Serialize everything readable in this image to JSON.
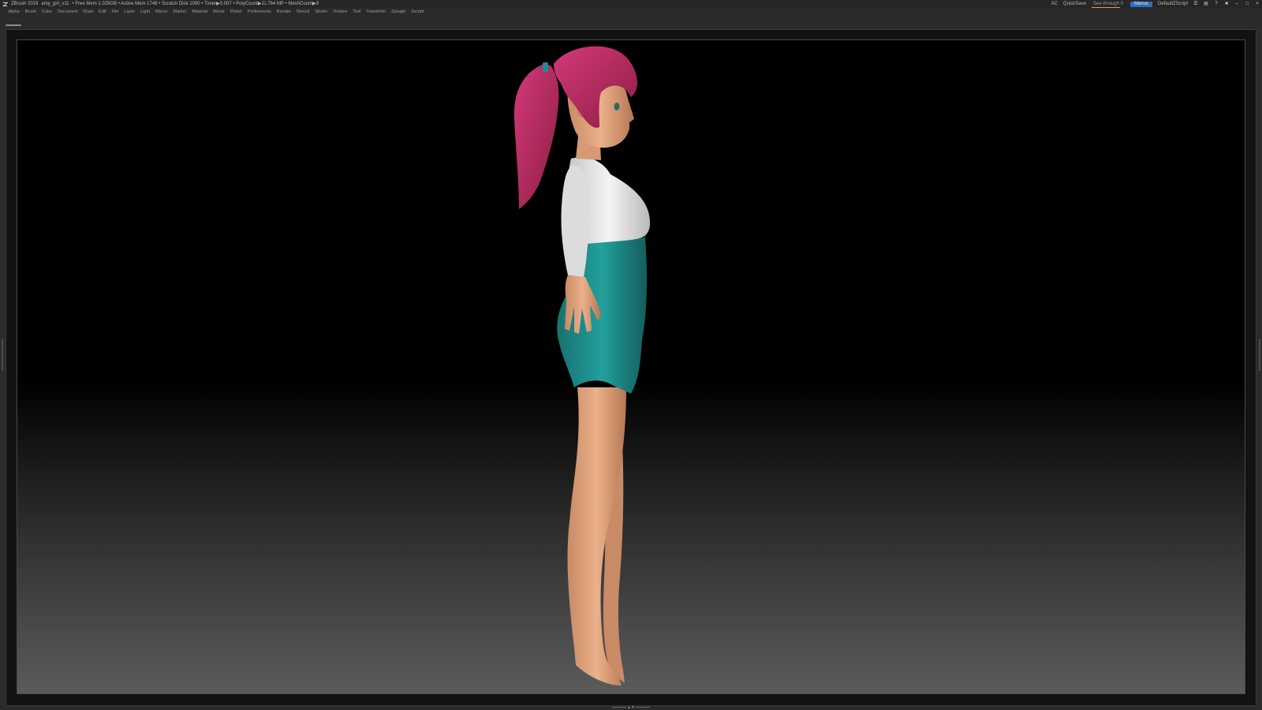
{
  "titlebar": {
    "app": "ZBrush 2019",
    "document": "amy_girl_v11",
    "stats": "• Free Mem 1.029GB • Active Mem 1748 • Scratch Disk 1090 • Timer▶0.007 • PolyCount▶11.764 MP • MeshCount▶9",
    "ac": "AC",
    "quicksave": "QuickSave",
    "see_through": "See-through  0",
    "menus_btn": "Menus",
    "script": "DefaultZScript"
  },
  "menubar": {
    "items": [
      "Alpha",
      "Brush",
      "Color",
      "Document",
      "Draw",
      "Edit",
      "File",
      "Layer",
      "Light",
      "Macro",
      "Marker",
      "Material",
      "Movie",
      "Picker",
      "Preferences",
      "Render",
      "Stencil",
      "Stroke",
      "Texture",
      "Tool",
      "Transform",
      "Zplugin",
      "Zscript"
    ]
  },
  "colors": {
    "hair": "#b8295c",
    "skin": "#e5a57f",
    "shirt": "#e8e8e8",
    "dress": "#1d8f8c",
    "menu_accent": "#2e6fb6",
    "seethrough_accent": "#e0a13a"
  },
  "icons": [
    "zbrush-logo-icon",
    "lightbox-icon",
    "script-icon",
    "help-icon",
    "minimize-icon",
    "restore-icon",
    "close-icon"
  ]
}
